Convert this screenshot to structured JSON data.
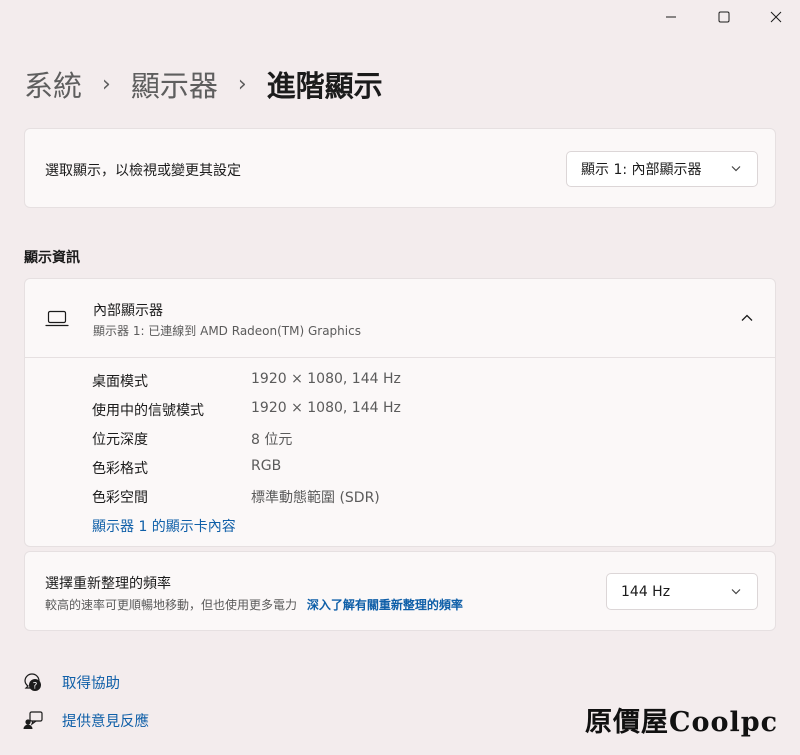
{
  "window": {
    "minimize_icon": "minimize-icon",
    "maximize_icon": "maximize-icon",
    "close_icon": "close-icon"
  },
  "breadcrumb": {
    "items": [
      "系統",
      "顯示器",
      "進階顯示"
    ],
    "separator": "›"
  },
  "select_display": {
    "label": "選取顯示，以檢視或變更其設定",
    "dropdown_value": "顯示 1: 內部顯示器"
  },
  "display_info": {
    "section_title": "顯示資訊",
    "monitor_name": "內部顯示器",
    "monitor_subtitle": "顯示器 1: 已連線到 AMD Radeon(TM) Graphics",
    "rows": [
      {
        "label": "桌面模式",
        "value": "1920 × 1080, 144 Hz"
      },
      {
        "label": "使用中的信號模式",
        "value": "1920 × 1080, 144 Hz"
      },
      {
        "label": "位元深度",
        "value": "8 位元"
      },
      {
        "label": "色彩格式",
        "value": "RGB"
      },
      {
        "label": "色彩空間",
        "value": "標準動態範圍 (SDR)"
      }
    ],
    "adapter_link": "顯示器 1 的顯示卡內容"
  },
  "refresh_rate": {
    "title": "選擇重新整理的頻率",
    "description": "較高的速率可更順暢地移動，但也使用更多電力",
    "learn_more": "深入了解有關重新整理的頻率",
    "dropdown_value": "144 Hz"
  },
  "footer": {
    "help": "取得協助",
    "feedback": "提供意見反應"
  },
  "watermark": {
    "text": "原價屋Coolpc"
  },
  "colors": {
    "background": "#f3eced",
    "card": "#fbf8f8",
    "link": "#0f5fa8"
  }
}
